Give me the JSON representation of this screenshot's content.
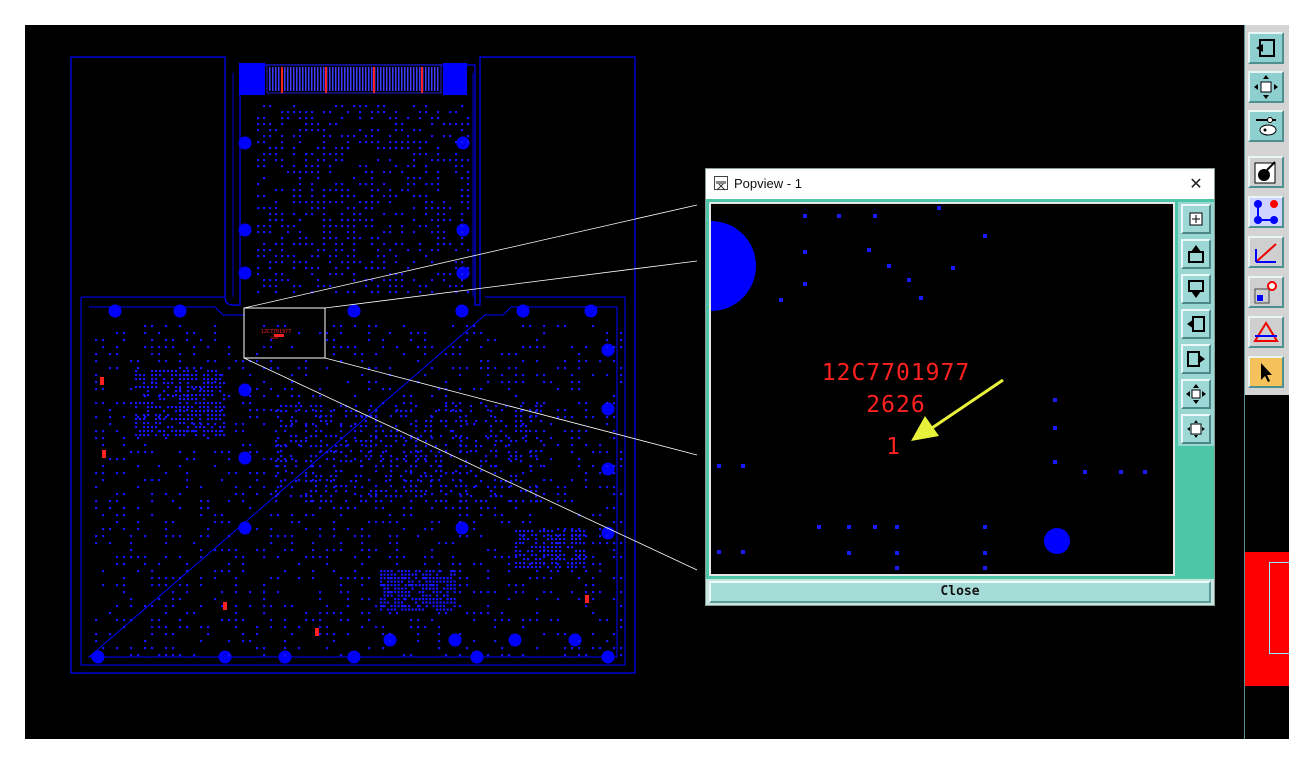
{
  "board": {
    "component_label": "12C7701977",
    "component_sub": "2626"
  },
  "popview": {
    "title": "Popview - 1",
    "close_label": "Close",
    "ref_line1": "12C7701977",
    "ref_line2": "2626",
    "ref_line3": "1",
    "arrow_color": "#e8f23a"
  },
  "toolbar": {
    "icons": [
      "panel-left-icon",
      "zoom-fit-icon",
      "settings-icon",
      "layer-icon",
      "net-icon",
      "measure-icon",
      "pin-icon",
      "drc-icon",
      "select-pointer-icon"
    ]
  },
  "popview_toolbar": {
    "icons": [
      "zoom-in-icon",
      "pan-up-icon",
      "pan-down-icon",
      "pan-left-icon",
      "pan-right-icon",
      "fit-icon",
      "zoom-out-icon"
    ]
  },
  "colors": {
    "background": "#000000",
    "trace": "#0000ff",
    "label": "#ff2020",
    "accent": "#4dc6a8"
  }
}
